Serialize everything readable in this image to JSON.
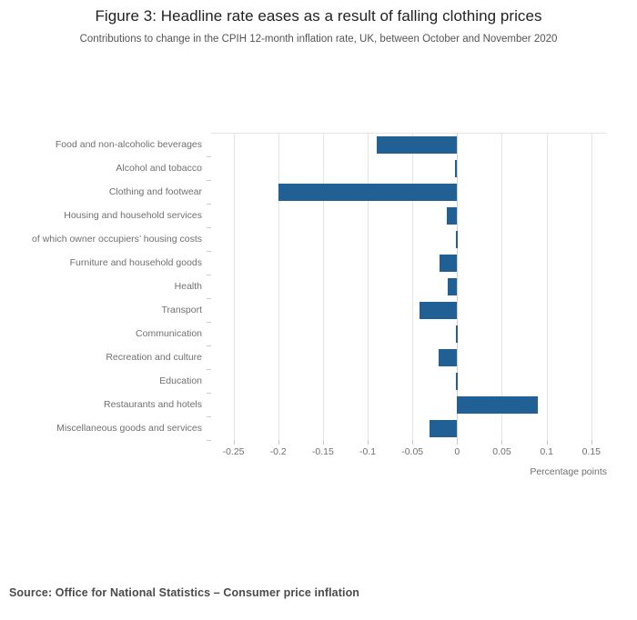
{
  "chart_data": {
    "type": "bar",
    "orientation": "horizontal",
    "title": "Figure 3: Headline rate eases as a result of falling clothing prices",
    "subtitle": "Contributions to change in the CPIH 12-month inflation rate, UK, between October and November 2020",
    "xlabel": "Percentage points",
    "ylabel": "",
    "xlim": [
      -0.275,
      0.1675
    ],
    "xticks": [
      -0.25,
      -0.2,
      -0.15,
      -0.1,
      -0.05,
      0,
      0.05,
      0.1,
      0.15
    ],
    "xticklabels": [
      "-0.25",
      "-0.2",
      "-0.15",
      "-0.1",
      "-0.05",
      "0",
      "0.05",
      "0.1",
      "0.15"
    ],
    "grid": true,
    "grid_axis": "x",
    "legend": false,
    "bar_color": "#206095",
    "categories": [
      "Food and non-alcoholic beverages",
      "Alcohol and tobacco",
      "Clothing and footwear",
      "Housing and household services",
      "of which owner occupiers’ housing costs",
      "Furniture and household goods",
      "Health",
      "Transport",
      "Communication",
      "Recreation and culture",
      "Education",
      "Restaurants and hotels",
      "Miscellaneous goods and services"
    ],
    "values": [
      -0.09,
      -0.002,
      -0.2,
      -0.012,
      -0.001,
      -0.02,
      -0.011,
      -0.042,
      -0.001,
      -0.021,
      -0.001,
      0.09,
      -0.031
    ]
  },
  "source": {
    "text": "Source: Office for National Statistics – Consumer price inflation"
  }
}
